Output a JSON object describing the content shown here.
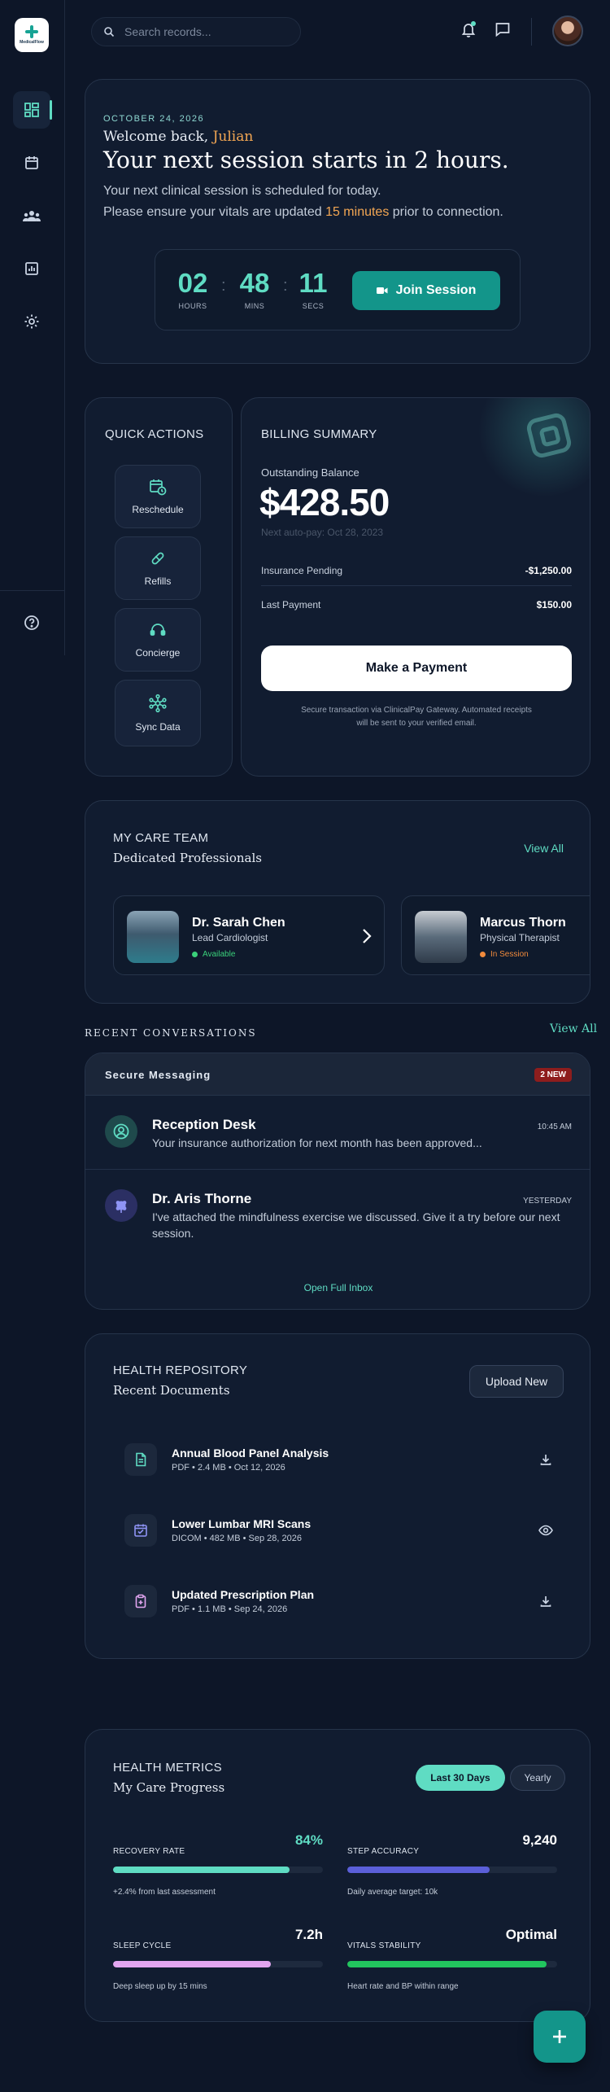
{
  "brand": {
    "logo_text": "MedicalFlow"
  },
  "search": {
    "placeholder": "Search records..."
  },
  "sidebar": {
    "items": [
      {
        "name": "dashboard",
        "icon": "dashboard-icon",
        "active": true
      },
      {
        "name": "calendar",
        "icon": "calendar-icon",
        "active": false
      },
      {
        "name": "team",
        "icon": "team-icon",
        "active": false
      },
      {
        "name": "reports",
        "icon": "bar-chart-icon",
        "active": false
      },
      {
        "name": "settings",
        "icon": "gear-icon",
        "active": false
      },
      {
        "name": "help",
        "icon": "help-icon",
        "active": false
      }
    ]
  },
  "hero": {
    "date": "OCTOBER 24, 2026",
    "welcome_prefix": "Welcome back,",
    "user_name": "Julian",
    "title": "Your next session starts in 2 hours.",
    "sub_line1": "Your next clinical session is scheduled for today.",
    "sub_line2_prefix": "Please ensure your vitals are updated",
    "sub_line2_highlight": "15 minutes",
    "sub_line2_suffix": "prior to connection.",
    "timer": {
      "hours": "02",
      "hours_label": "HOURS",
      "mins": "48",
      "mins_label": "MINS",
      "secs": "11",
      "secs_label": "SECS"
    },
    "join_label": "Join Session"
  },
  "quick_actions": {
    "title": "QUICK ACTIONS",
    "items": [
      {
        "label": "Reschedule",
        "icon": "calendar-clock-icon"
      },
      {
        "label": "Refills",
        "icon": "pill-icon"
      },
      {
        "label": "Concierge",
        "icon": "headset-icon"
      },
      {
        "label": "Sync Data",
        "icon": "network-icon"
      }
    ]
  },
  "billing": {
    "title": "BILLING SUMMARY",
    "balance_label": "Outstanding Balance",
    "balance": "$428.50",
    "autopay": "Next auto-pay: Oct 28, 2023",
    "rows": [
      {
        "label": "Insurance Pending",
        "value": "-$1,250.00"
      },
      {
        "label": "Last Payment",
        "value": "$150.00"
      }
    ],
    "pay_label": "Make a Payment",
    "note": "Secure transaction via ClinicalPay Gateway. Automated receipts will be sent to your verified email."
  },
  "care_team": {
    "title": "MY CARE TEAM",
    "subtitle": "Dedicated Professionals",
    "view_all": "View All",
    "members": [
      {
        "name": "Dr. Sarah Chen",
        "role": "Lead Cardiologist",
        "status": "Available",
        "status_color": "#3ad07a"
      },
      {
        "name": "Marcus Thorn",
        "role": "Physical Therapist",
        "status": "In Session",
        "status_color": "#f08a3c"
      }
    ]
  },
  "conversations": {
    "heading": "RECENT CONVERSATIONS",
    "view_all": "View All",
    "bar_title": "Secure Messaging",
    "badge": "2 NEW",
    "messages": [
      {
        "from": "Reception Desk",
        "time": "10:45 AM",
        "text": "Your insurance authorization for next month has been approved...",
        "icon": "user-circle-icon"
      },
      {
        "from": "Dr. Aris Thorne",
        "time": "YESTERDAY",
        "text": "I've attached the mindfulness exercise we discussed. Give it a try before our next session.",
        "icon": "brain-icon"
      }
    ],
    "open_inbox": "Open Full Inbox"
  },
  "repository": {
    "title": "HEALTH REPOSITORY",
    "subtitle": "Recent Documents",
    "upload_label": "Upload New",
    "files": [
      {
        "name": "Annual Blood Panel Analysis",
        "meta": "PDF • 2.4 MB • Oct 12, 2026",
        "icon": "document-icon",
        "action_icon": "download-icon"
      },
      {
        "name": "Lower Lumbar MRI Scans",
        "meta": "DICOM • 482 MB • Sep 28, 2026",
        "icon": "scan-icon",
        "action_icon": "eye-icon"
      },
      {
        "name": "Updated Prescription Plan",
        "meta": "PDF • 1.1 MB • Sep 24, 2026",
        "icon": "prescription-icon",
        "action_icon": "download-icon"
      }
    ]
  },
  "metrics": {
    "title": "HEALTH METRICS",
    "subtitle": "My Care Progress",
    "range_active": "Last 30 Days",
    "range_other": "Yearly",
    "items": [
      {
        "label": "RECOVERY RATE",
        "value": "84%",
        "fraction": 0.84,
        "note": "+2.4% from last assessment",
        "color": "#5fdcc3",
        "value_color": "#5fdcc3"
      },
      {
        "label": "STEP ACCURACY",
        "value": "9,240",
        "fraction": 0.68,
        "note": "Daily average target: 10k",
        "color": "#5b5fd9",
        "value_color": "#ffffff"
      },
      {
        "label": "SLEEP CYCLE",
        "value": "7.2h",
        "fraction": 0.75,
        "note": "Deep sleep up by 15 mins",
        "color": "#e2a5f0",
        "value_color": "#ffffff"
      },
      {
        "label": "VITALS STABILITY",
        "value": "Optimal",
        "fraction": 0.95,
        "note": "Heart rate and BP within range",
        "color": "#22c55e",
        "value_color": "#ffffff"
      }
    ]
  }
}
